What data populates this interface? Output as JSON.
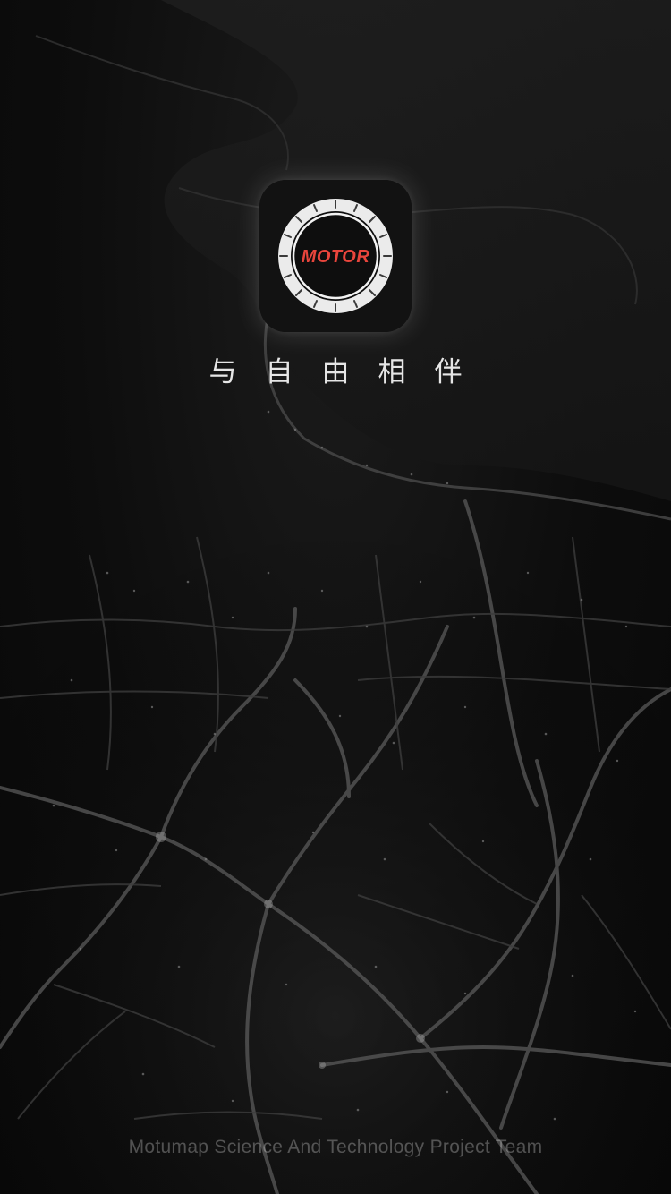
{
  "splash": {
    "logo_text": "MOTOR",
    "slogan": "与自由相伴",
    "footer_team": "Motumap Science And Technology Project Team"
  },
  "colors": {
    "background": "#0b0b0b",
    "logo_accent": "#e8453c",
    "tire_ring": "#e8e8e8",
    "map_roads": "#5a5a5a"
  },
  "icons": {
    "app_logo": "tire-wheel-icon"
  }
}
